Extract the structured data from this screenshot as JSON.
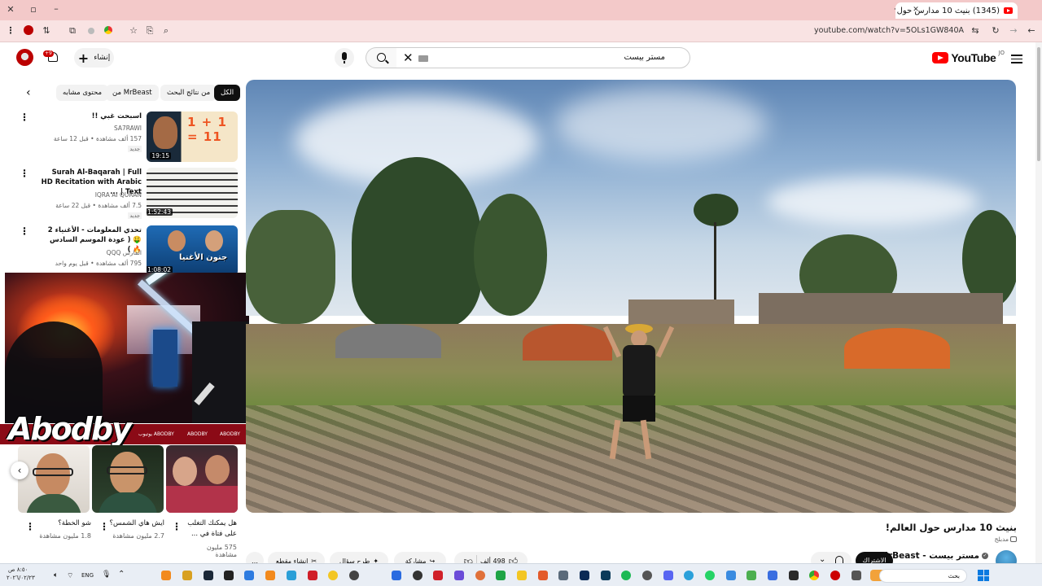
{
  "browser": {
    "tab_title": "(1345) بنيث 10 مدارس حول العالم...",
    "url": "youtube.com/watch?v=5OLs1GW840A"
  },
  "header": {
    "logo_text": "YouTube",
    "logo_country": "JO",
    "search_value": "مستر بيست",
    "create_label": "إنشاء",
    "notifications_badge": "+9"
  },
  "chips": [
    {
      "label": "الكل",
      "active": true
    },
    {
      "label": "من نتائج البحث",
      "active": false
    },
    {
      "label": "من MrBeast",
      "active": false
    },
    {
      "label": "محتوى مشابه",
      "active": false
    }
  ],
  "recommendations": [
    {
      "title": "اسبحت غبي !!",
      "channel": "SA7RAWI",
      "meta": "157 ألف مشاهدة • قبل 12 ساعة",
      "badge": "جديد",
      "duration": "19:15",
      "thumb_text": "1 + 1 = 11"
    },
    {
      "title": "Surah Al-Baqarah | Full HD Recitation with Arabic Text | ...",
      "channel": "IQRA AI QURAN",
      "meta": "7.5 ألف مشاهدة • قبل 22 ساعة",
      "badge": "جديد",
      "duration": "1:52:43",
      "thumb_text": ""
    },
    {
      "title": "تحدي المعلومات - الأغنياء 2 🤑 ( عودة الموسم السادس 🔥 )",
      "channel": "الفارس QQQ",
      "meta": "795 ألف مشاهدة • قبل يوم واحد",
      "badge": "",
      "duration": "1:08:02",
      "thumb_text": "جنون الأغنيا"
    }
  ],
  "webcam": {
    "streamer_name": "Abodby",
    "strip_items": [
      "ABODBY",
      "ABODBY",
      "يوتيوب ABODBY"
    ]
  },
  "shorts": [
    {
      "title": "هل يمكنك التغلب على فتاة في ...",
      "views": "575 مليون مشاهدة"
    },
    {
      "title": "ايش هاي الشمس؟",
      "views": "2.7 مليون مشاهدة"
    },
    {
      "title": "شو الخطة؟",
      "views": "1.8 مليون مشاهدة"
    }
  ],
  "video": {
    "title": "بنيث 10 مدارس حول العالم!",
    "dub_label": "مدبلج",
    "channel": "مستر بيست - MrBeast",
    "subscribe_label": "الاشتراك",
    "likes": "498 ألف",
    "share_label": "مشاركة",
    "ask_label": "طرح سؤال",
    "clip_label": "إنشاء مقطع"
  },
  "taskbar": {
    "search_placeholder": "بحث",
    "language": "ENG",
    "time": "٨:٥٠ ص",
    "date": "٢٠٢٦/٠٢/٢٣"
  },
  "colors": {
    "brand_red": "#ff0000",
    "tabbar_bg": "#f3c9c9",
    "addrbar_bg": "#f9e3e3"
  }
}
